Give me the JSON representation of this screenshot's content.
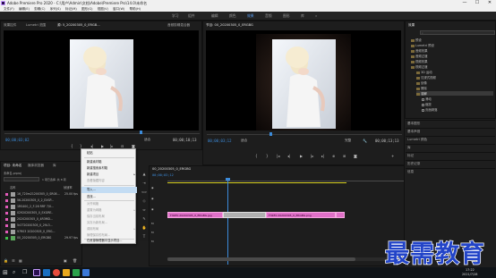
{
  "window": {
    "title": "Adobe Premiere Pro 2020 - C:\\用户\\Admin\\文档\\Adobe\\Premiere Pro\\14.0\\未命名",
    "minimize": "—",
    "maximize": "☐",
    "close": "✕"
  },
  "menu": [
    "文件(F)",
    "编辑(E)",
    "剪辑(C)",
    "序列(S)",
    "标记(M)",
    "图形(G)",
    "视图(V)",
    "窗口(W)",
    "帮助(H)"
  ],
  "workspaces": {
    "items": [
      "学习",
      "组件",
      "编辑",
      "颜色",
      "效果",
      "音频",
      "图形",
      "库"
    ],
    "active_index": 4,
    "more": "»"
  },
  "source": {
    "tabs": [
      "效果控件",
      "Lumetri 范围",
      "源: 5_20200305_0_ERGB...",
      "音频剪辑混合器"
    ],
    "timecode_in": "00;00;03;02",
    "timecode_out": "00;00;10;13",
    "fit": "适合"
  },
  "program": {
    "tab": "节目: 00_20200305_0_ERGBG",
    "timecode_in": "00;00;03;12",
    "timecode_out": "00;00;13;13",
    "fit": "适合",
    "quality": "完整"
  },
  "effects": {
    "title": "效果",
    "items": [
      "预设",
      "Lumetri 预设",
      "音频效果",
      "音频过渡",
      "视频效果",
      "视频过渡",
      "3D 运动",
      "沉浸式视频",
      "划像",
      "擦除",
      "溶解",
      "滑动",
      "缩放",
      "页面剥落"
    ],
    "selected_index": 10
  },
  "right_panels": [
    "基本图形",
    "基本声音",
    "Lumetri 颜色",
    "库",
    "标记",
    "历史记录",
    "信息"
  ],
  "project": {
    "tabs": [
      "项目: 未命名",
      "媒体浏览器",
      "库"
    ],
    "name": "未命名.prproj",
    "item_count": "1 项已选择, 共 8 项",
    "column_name": "名称",
    "column_rate": "帧速率",
    "rows": [
      {
        "name": "16_720m21200305_0_SR08...",
        "rate": "25.00 fps"
      },
      {
        "name": "56-20200305_0_2_EXSP...",
        "rate": ""
      },
      {
        "name": "1RS400_2_F-26 RRF 7/0...",
        "rate": ""
      },
      {
        "name": "02920200305_0_EXGRE..",
        "rate": ""
      },
      {
        "name": "2020200305_0_4R3MD...",
        "rate": ""
      },
      {
        "name": "5r2T20200305_0_29L3...",
        "rate": ""
      },
      {
        "name": "97R03 20200305_0_ERG...",
        "rate": ""
      },
      {
        "name": "00_20200305_0_ERGBG",
        "rate": "29.97 fps"
      }
    ]
  },
  "context_menu": {
    "items": [
      {
        "label": "粘贴",
        "disabled": false
      },
      {
        "label": "新建素材箱",
        "disabled": false
      },
      {
        "label": "新建搜索素材箱",
        "disabled": false
      },
      {
        "label": "新建项目",
        "disabled": false,
        "submenu": true
      },
      {
        "label": "查看隐藏内容",
        "disabled": true
      },
      {
        "label": "导入...",
        "disabled": false,
        "highlighted": true
      },
      {
        "label": "查找...",
        "disabled": false
      },
      {
        "label": "对齐网格",
        "disabled": true
      },
      {
        "label": "重置为网格",
        "disabled": true,
        "submenu": true
      },
      {
        "label": "保存当前布局",
        "disabled": true
      },
      {
        "label": "另存为新布局...",
        "disabled": true
      },
      {
        "label": "调用布局",
        "disabled": true,
        "submenu": true
      },
      {
        "label": "管理保存的布局...",
        "disabled": true
      },
      {
        "label": "在资源管理器中显示项目...",
        "disabled": false
      }
    ]
  },
  "timeline": {
    "tab": "00_20200305_0_ERGBG",
    "timecode": "00;00;03;12",
    "clips": [
      {
        "label": "F3RF0 20200305_0_ERGBG.jpg",
        "kind": "clip"
      },
      {
        "label": "",
        "kind": "transition"
      },
      {
        "label": "F3RF0 20200305_0_ERGBG.png",
        "kind": "clip"
      },
      {
        "label": "",
        "kind": "end"
      }
    ]
  },
  "taskbar": {
    "time": "17:22",
    "date": "2021/7/28"
  },
  "watermark": "最需教育",
  "colors": {
    "accent_blue": "#3c8bd9",
    "clip_pink": "#e070c8",
    "watermark_blue": "#2244c8"
  }
}
